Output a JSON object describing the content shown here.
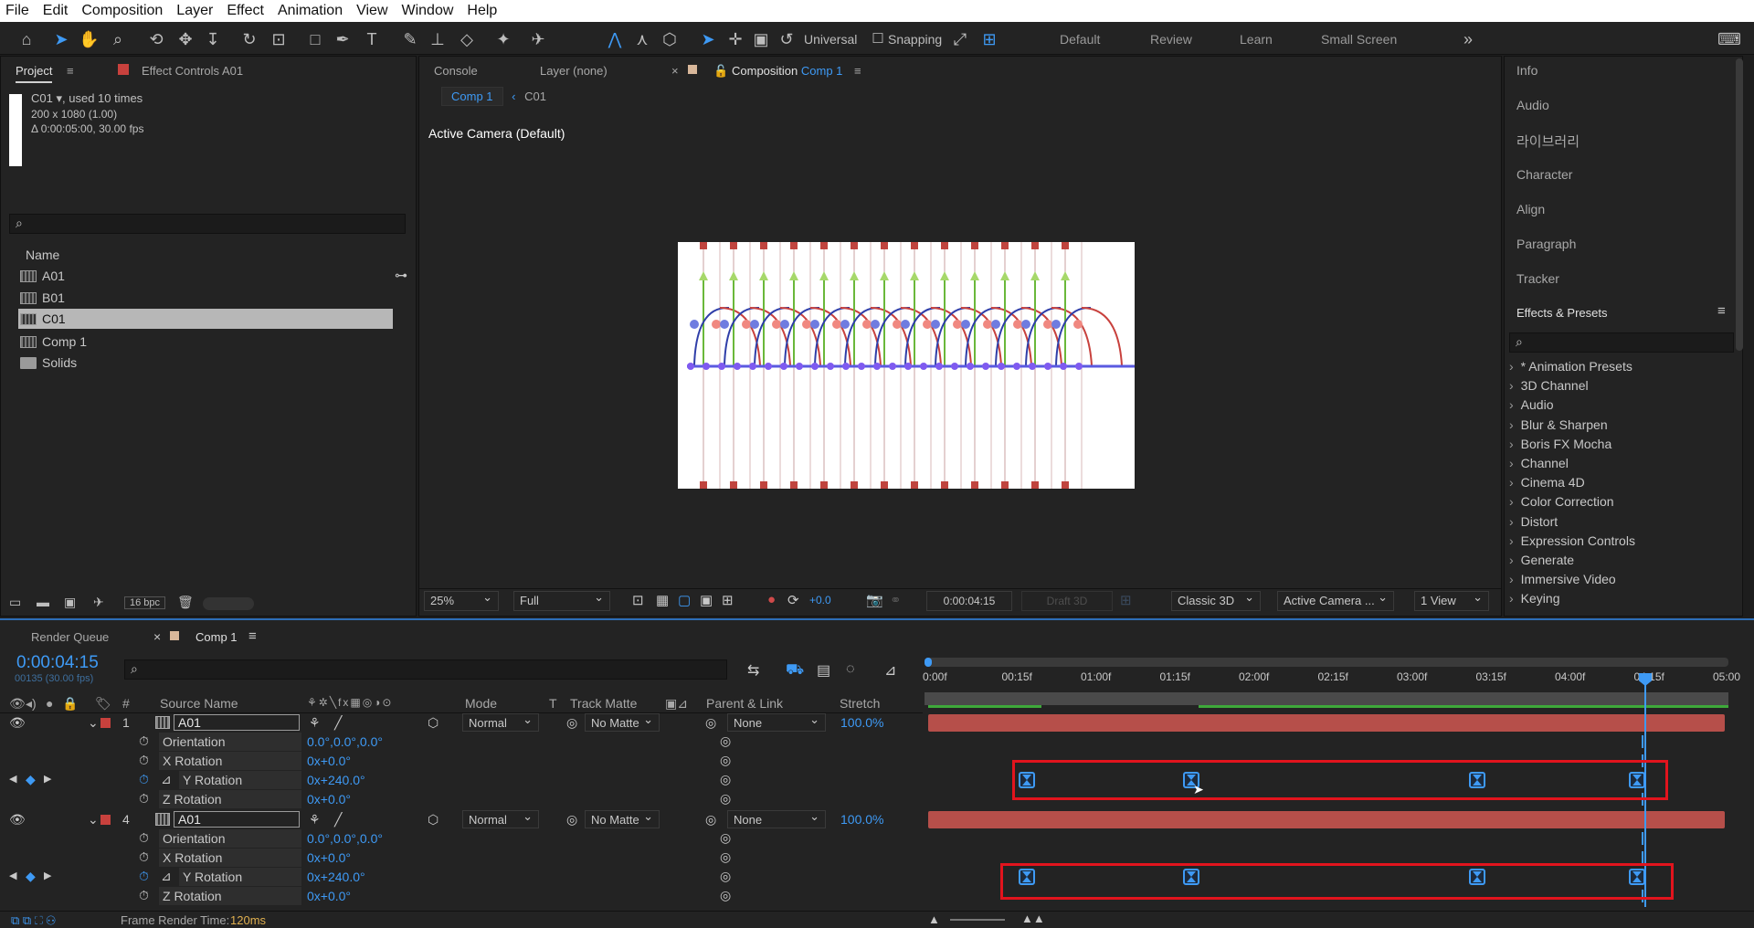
{
  "menu": [
    "File",
    "Edit",
    "Composition",
    "Layer",
    "Effect",
    "Animation",
    "View",
    "Window",
    "Help"
  ],
  "toolbar": {
    "axis_mode": "Universal",
    "snapping": "Snapping",
    "workspaces": [
      "Default",
      "Review",
      "Learn",
      "Small Screen"
    ]
  },
  "project": {
    "tab": "Project",
    "effect_controls": "Effect Controls",
    "effect_controls_target": "A01",
    "selected_name": "C01",
    "used_times": ", used 10 times",
    "dims": "200 x 1080 (1.00)",
    "duration": "Δ 0:00:05:00, 30.00 fps",
    "col_name": "Name",
    "items": [
      "A01",
      "B01",
      "C01",
      "Comp 1",
      "Solids"
    ],
    "bpc": "16 bpc"
  },
  "viewer": {
    "tabs": [
      "Console",
      "Layer (none)",
      "Composition",
      "Comp 1"
    ],
    "breadcrumb": [
      "Comp 1",
      "C01"
    ],
    "camera_label": "Active Camera (Default)",
    "zoom": "25%",
    "resolution": "Full",
    "exposure": "+0.0",
    "timecode": "0:00:04:15",
    "draft3d": "Draft 3D",
    "renderer": "Classic 3D",
    "camera": "Active Camera ...",
    "views": "1 View"
  },
  "right_panel": {
    "items": [
      "Info",
      "Audio",
      "라이브러리",
      "Character",
      "Align",
      "Paragraph",
      "Tracker"
    ],
    "effects_title": "Effects & Presets",
    "effects": [
      "* Animation Presets",
      "3D Channel",
      "Audio",
      "Blur & Sharpen",
      "Boris FX Mocha",
      "Channel",
      "Cinema 4D",
      "Color Correction",
      "Distort",
      "Expression Controls",
      "Generate",
      "Immersive Video",
      "Keying"
    ]
  },
  "timeline": {
    "tabs": [
      "Render Queue",
      "Comp 1"
    ],
    "timecode": "0:00:04:15",
    "frame_info": "00135 (30.00 fps)",
    "headers": {
      "source": "Source Name",
      "mode": "Mode",
      "t": "T",
      "track_matte": "Track Matte",
      "parent": "Parent & Link",
      "stretch": "Stretch"
    },
    "ruler": [
      "0:00f",
      "00:15f",
      "01:00f",
      "01:15f",
      "02:00f",
      "02:15f",
      "03:00f",
      "03:15f",
      "04:00f",
      "04:15f",
      "05:00"
    ],
    "layers": [
      {
        "num": "1",
        "name": "A01",
        "mode": "Normal",
        "matte": "No Matte",
        "parent": "None",
        "stretch": "100.0%",
        "props": [
          {
            "name": "Orientation",
            "value": "0.0°,0.0°,0.0°"
          },
          {
            "name": "X Rotation",
            "value": "0x+0.0°"
          },
          {
            "name": "Y Rotation",
            "value": "0x+240.0°"
          },
          {
            "name": "Z Rotation",
            "value": "0x+0.0°"
          }
        ]
      },
      {
        "num": "4",
        "name": "A01",
        "mode": "Normal",
        "matte": "No Matte",
        "parent": "None",
        "stretch": "100.0%",
        "props": [
          {
            "name": "Orientation",
            "value": "0.0°,0.0°,0.0°"
          },
          {
            "name": "X Rotation",
            "value": "0x+0.0°"
          },
          {
            "name": "Y Rotation",
            "value": "0x+240.0°"
          },
          {
            "name": "Z Rotation",
            "value": "0x+0.0°"
          }
        ]
      }
    ],
    "status": "Frame Render Time:",
    "render_time": "120ms"
  }
}
